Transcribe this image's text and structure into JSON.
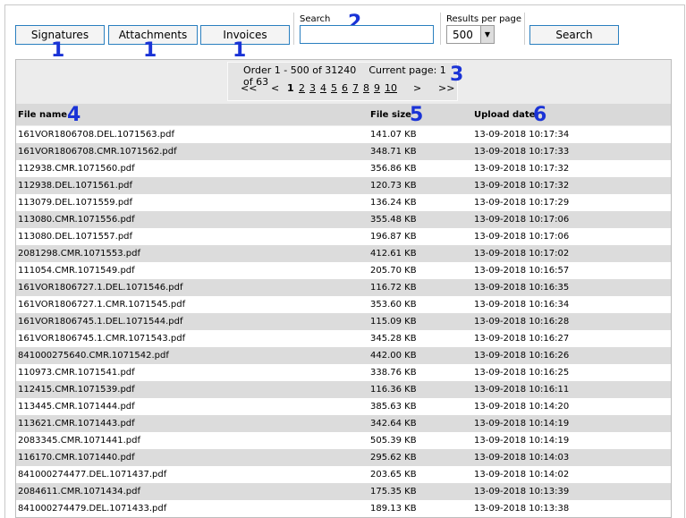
{
  "toolbar": {
    "tabs": [
      "Signatures",
      "Attachments",
      "Invoices"
    ],
    "search_label": "Search",
    "search_value": "",
    "results_label": "Results per page",
    "results_value": "500",
    "search_button": "Search"
  },
  "annotations": {
    "tabs": "1",
    "search": "2",
    "pager": "3",
    "file_name": "4",
    "file_size": "5",
    "upload_date": "6"
  },
  "pager": {
    "order_text": "Order 1 - 500 of 31240",
    "current_page_text": "Current page: 1 of 63",
    "first": "<<",
    "prev": "<",
    "pages": [
      "1",
      "2",
      "3",
      "4",
      "5",
      "6",
      "7",
      "8",
      "9",
      "10"
    ],
    "next": ">",
    "last": ">>"
  },
  "table": {
    "columns": [
      "File name",
      "File size",
      "Upload date"
    ],
    "rows": [
      [
        "161VOR1806708.DEL.1071563.pdf",
        "141.07 KB",
        "13-09-2018 10:17:34"
      ],
      [
        "161VOR1806708.CMR.1071562.pdf",
        "348.71 KB",
        "13-09-2018 10:17:33"
      ],
      [
        "112938.CMR.1071560.pdf",
        "356.86 KB",
        "13-09-2018 10:17:32"
      ],
      [
        "112938.DEL.1071561.pdf",
        "120.73 KB",
        "13-09-2018 10:17:32"
      ],
      [
        "113079.DEL.1071559.pdf",
        "136.24 KB",
        "13-09-2018 10:17:29"
      ],
      [
        "113080.CMR.1071556.pdf",
        "355.48 KB",
        "13-09-2018 10:17:06"
      ],
      [
        "113080.DEL.1071557.pdf",
        "196.87 KB",
        "13-09-2018 10:17:06"
      ],
      [
        "2081298.CMR.1071553.pdf",
        "412.61 KB",
        "13-09-2018 10:17:02"
      ],
      [
        "111054.CMR.1071549.pdf",
        "205.70 KB",
        "13-09-2018 10:16:57"
      ],
      [
        "161VOR1806727.1.DEL.1071546.pdf",
        "116.72 KB",
        "13-09-2018 10:16:35"
      ],
      [
        "161VOR1806727.1.CMR.1071545.pdf",
        "353.60 KB",
        "13-09-2018 10:16:34"
      ],
      [
        "161VOR1806745.1.DEL.1071544.pdf",
        "115.09 KB",
        "13-09-2018 10:16:28"
      ],
      [
        "161VOR1806745.1.CMR.1071543.pdf",
        "345.28 KB",
        "13-09-2018 10:16:27"
      ],
      [
        "841000275640.CMR.1071542.pdf",
        "442.00 KB",
        "13-09-2018 10:16:26"
      ],
      [
        "110973.CMR.1071541.pdf",
        "338.76 KB",
        "13-09-2018 10:16:25"
      ],
      [
        "112415.CMR.1071539.pdf",
        "116.36 KB",
        "13-09-2018 10:16:11"
      ],
      [
        "113445.CMR.1071444.pdf",
        "385.63 KB",
        "13-09-2018 10:14:20"
      ],
      [
        "113621.CMR.1071443.pdf",
        "342.64 KB",
        "13-09-2018 10:14:19"
      ],
      [
        "2083345.CMR.1071441.pdf",
        "505.39 KB",
        "13-09-2018 10:14:19"
      ],
      [
        "116170.CMR.1071440.pdf",
        "295.62 KB",
        "13-09-2018 10:14:03"
      ],
      [
        "841000274477.DEL.1071437.pdf",
        "203.65 KB",
        "13-09-2018 10:14:02"
      ],
      [
        "2084611.CMR.1071434.pdf",
        "175.35 KB",
        "13-09-2018 10:13:39"
      ],
      [
        "841000274479.DEL.1071433.pdf",
        "189.13 KB",
        "13-09-2018 10:13:38"
      ]
    ]
  }
}
